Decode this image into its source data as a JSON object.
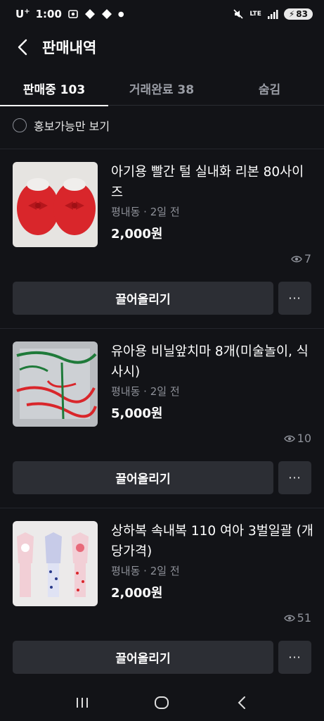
{
  "status_bar": {
    "carrier": "U",
    "carrier_sup": "+",
    "time": "1:00",
    "network": "LTE",
    "battery": "83"
  },
  "header": {
    "title": "판매내역"
  },
  "tabs": [
    {
      "label": "판매중 103",
      "active": true
    },
    {
      "label": "거래완료 38",
      "active": false
    },
    {
      "label": "숨김",
      "active": false
    }
  ],
  "filter": {
    "label": "홍보가능만 보기"
  },
  "items": [
    {
      "title": "아기용 빨간 털 실내화 리본 80사이즈",
      "meta": "평내동 · 2일 전",
      "price": "2,000원",
      "views": "7",
      "bump_label": "끌어올리기",
      "more_label": "···",
      "thumb_icon": "red-fluffy-slippers-photo"
    },
    {
      "title": "유아용 비닐앞치마 8개(미술놀이, 식사시)",
      "meta": "평내동 · 2일 전",
      "price": "5,000원",
      "views": "10",
      "bump_label": "끌어올리기",
      "more_label": "···",
      "thumb_icon": "vinyl-aprons-photo"
    },
    {
      "title": "상하복 속내복 110 여아 3벌일괄 (개당가격)",
      "meta": "평내동 · 2일 전",
      "price": "2,000원",
      "views": "51",
      "bump_label": "끌어올리기",
      "more_label": "···",
      "thumb_icon": "kids-pajamas-photo"
    }
  ],
  "colors": {
    "background": "#121317",
    "button": "#2c2e34",
    "muted": "#8e9199"
  }
}
